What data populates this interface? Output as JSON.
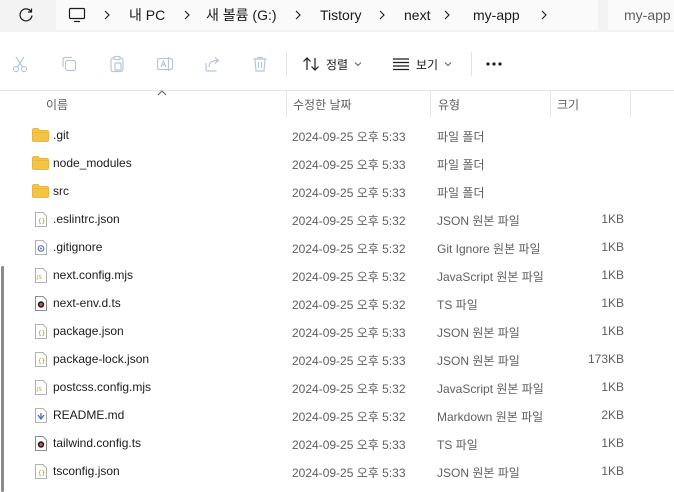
{
  "address": {
    "breadcrumbs": [
      "내 PC",
      "새 볼륨 (G:)",
      "Tistory",
      "next",
      "my-app"
    ],
    "search_placeholder": "my-app"
  },
  "toolbar": {
    "sort_label": "정렬",
    "view_label": "보기"
  },
  "columns": {
    "name": "이름",
    "modified": "수정한 날짜",
    "type": "유형",
    "size": "크기"
  },
  "files": [
    {
      "name": ".git",
      "modified": "2024-09-25 오후 5:33",
      "type": "파일 폴더",
      "size": "",
      "icon": "folder-icon"
    },
    {
      "name": "node_modules",
      "modified": "2024-09-25 오후 5:33",
      "type": "파일 폴더",
      "size": "",
      "icon": "folder-icon"
    },
    {
      "name": "src",
      "modified": "2024-09-25 오후 5:33",
      "type": "파일 폴더",
      "size": "",
      "icon": "folder-icon"
    },
    {
      "name": ".eslintrc.json",
      "modified": "2024-09-25 오후 5:32",
      "type": "JSON 원본 파일",
      "size": "1KB",
      "icon": "json-file-icon"
    },
    {
      "name": ".gitignore",
      "modified": "2024-09-25 오후 5:32",
      "type": "Git Ignore 원본 파일",
      "size": "1KB",
      "icon": "gitignore-file-icon"
    },
    {
      "name": "next.config.mjs",
      "modified": "2024-09-25 오후 5:32",
      "type": "JavaScript 원본 파일",
      "size": "1KB",
      "icon": "js-file-icon"
    },
    {
      "name": "next-env.d.ts",
      "modified": "2024-09-25 오후 5:32",
      "type": "TS 파일",
      "size": "1KB",
      "icon": "ts-file-icon"
    },
    {
      "name": "package.json",
      "modified": "2024-09-25 오후 5:33",
      "type": "JSON 원본 파일",
      "size": "1KB",
      "icon": "json-file-icon"
    },
    {
      "name": "package-lock.json",
      "modified": "2024-09-25 오후 5:33",
      "type": "JSON 원본 파일",
      "size": "173KB",
      "icon": "json-file-icon"
    },
    {
      "name": "postcss.config.mjs",
      "modified": "2024-09-25 오후 5:32",
      "type": "JavaScript 원본 파일",
      "size": "1KB",
      "icon": "js-file-icon"
    },
    {
      "name": "README.md",
      "modified": "2024-09-25 오후 5:32",
      "type": "Markdown 원본 파일",
      "size": "2KB",
      "icon": "markdown-file-icon"
    },
    {
      "name": "tailwind.config.ts",
      "modified": "2024-09-25 오후 5:33",
      "type": "TS 파일",
      "size": "1KB",
      "icon": "ts-file-icon"
    },
    {
      "name": "tsconfig.json",
      "modified": "2024-09-25 오후 5:33",
      "type": "JSON 원본 파일",
      "size": "1KB",
      "icon": "json-file-icon"
    }
  ],
  "colors": {
    "folder": "#f5c443",
    "accent": "#0067c0",
    "disabled_icon": "#b5c8da"
  }
}
